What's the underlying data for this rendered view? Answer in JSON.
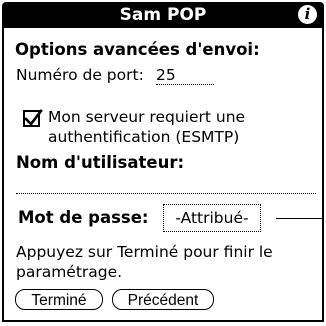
{
  "window": {
    "title": "Sam POP",
    "info_glyph": "i"
  },
  "form": {
    "options_heading": "Options avancées d'envoi:",
    "port_label": "Numéro de port:",
    "port_value": "25",
    "auth_checkbox_line1": "Mon serveur requiert une",
    "auth_checkbox_line2": "authentification (ESMTP)",
    "auth_checked": true,
    "username_label": "Nom d'utilisateur:",
    "username_value": "",
    "password_label": "Mot de passe:",
    "password_value": "-Attribué-",
    "instruction_line1": "Appuyez sur Terminé pour finir le",
    "instruction_line2": "paramétrage."
  },
  "buttons": {
    "done_label": "Terminé",
    "previous_label": "Précédent"
  },
  "icons": {
    "info": "info-icon",
    "check": "checkmark-icon"
  },
  "colors": {
    "foreground": "#000000",
    "background": "#ffffff"
  }
}
